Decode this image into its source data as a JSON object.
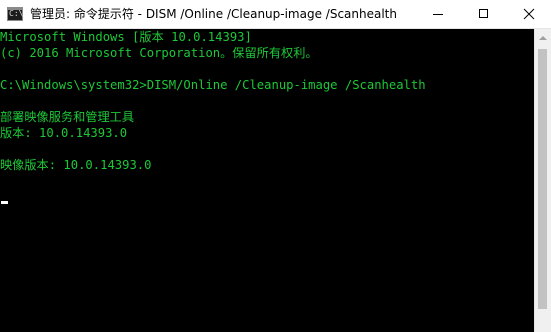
{
  "window": {
    "title": "管理员: 命令提示符 - DISM /Online /Cleanup-image /Scanhealth",
    "icon_prompt": "C:\\",
    "buttons": {
      "minimize": "minimize-icon",
      "maximize": "maximize-icon",
      "close": "close-icon"
    }
  },
  "console": {
    "text_color": "#1ec837",
    "background": "#000000",
    "lines": [
      "Microsoft Windows [版本 10.0.14393]",
      "(c) 2016 Microsoft Corporation。保留所有权利。",
      "",
      "C:\\Windows\\system32>DISM/Online /Cleanup-image /Scanhealth",
      "",
      "部署映像服务和管理工具",
      "版本: 10.0.14393.0",
      "",
      "映像版本: 10.0.14393.0"
    ]
  },
  "scrollbar": {
    "up_icon": "scroll-up-arrow-icon"
  }
}
